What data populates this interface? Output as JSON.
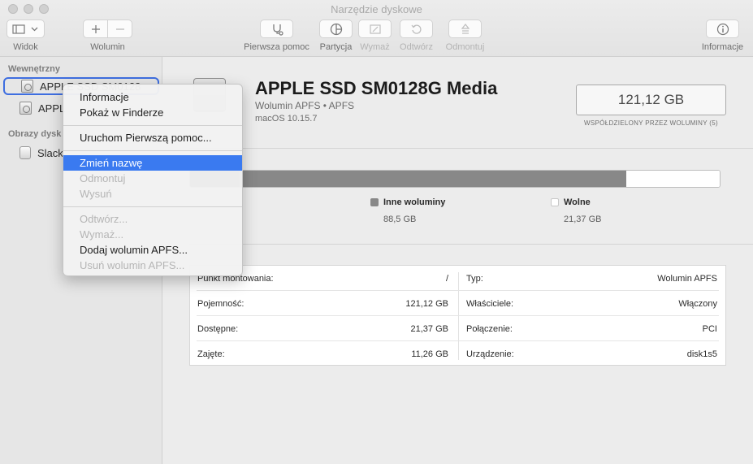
{
  "window": {
    "title": "Narzędzie dyskowe"
  },
  "toolbar": {
    "view_label": "Widok",
    "volume_label": "Wolumin",
    "firstaid_label": "Pierwsza pomoc",
    "partition_label": "Partycja",
    "erase_label": "Wymaż",
    "restore_label": "Odtwórz",
    "unmount_label": "Odmontuj",
    "info_label": "Informacje"
  },
  "sidebar": {
    "section_internal": "Wewnętrzny",
    "items_internal": [
      {
        "label": "APPLE SSD SM0128",
        "selected": true
      },
      {
        "label": "APPL"
      }
    ],
    "section_images": "Obrazy dysk",
    "items_images": [
      {
        "label": "Slack"
      }
    ]
  },
  "volume": {
    "name": "APPLE SSD SM0128G Media",
    "subtitle": "Wolumin APFS • APFS",
    "os": "macOS 10.15.7",
    "capacity": "121,12 GB",
    "capacity_caption": "WSPÓŁDZIELONY PRZEZ WOLUMINY (5)"
  },
  "usage": {
    "total_gb": 121.12,
    "segments": [
      {
        "name": "used",
        "value_gb": 11.26,
        "color": "#4a4a4a"
      },
      {
        "name": "other",
        "value_gb": 88.5,
        "color": "#888888"
      },
      {
        "name": "free",
        "value_gb": 21.37,
        "color": "#ffffff"
      }
    ],
    "other_label": "Inne woluminy",
    "other_value": "88,5 GB",
    "other_color": "#888888",
    "free_label": "Wolne",
    "free_value": "21,37 GB",
    "free_color": "#ffffff"
  },
  "info": {
    "rows": [
      {
        "lk": "Punkt montowania:",
        "lv": "/",
        "rk": "Typ:",
        "rv": "Wolumin APFS"
      },
      {
        "lk": "Pojemność:",
        "lv": "121,12 GB",
        "rk": "Właściciele:",
        "rv": "Włączony"
      },
      {
        "lk": "Dostępne:",
        "lv": "21,37 GB",
        "rk": "Połączenie:",
        "rv": "PCI"
      },
      {
        "lk": "Zajęte:",
        "lv": "11,26 GB",
        "rk": "Urządzenie:",
        "rv": "disk1s5"
      }
    ]
  },
  "context_menu": {
    "info": "Informacje",
    "show_finder": "Pokaż w Finderze",
    "first_aid": "Uruchom Pierwszą pomoc...",
    "rename": "Zmień nazwę",
    "unmount": "Odmontuj",
    "eject": "Wysuń",
    "restore": "Odtwórz...",
    "erase": "Wymaż...",
    "add_apfs": "Dodaj wolumin APFS...",
    "delete_apfs": "Usuń wolumin APFS..."
  }
}
